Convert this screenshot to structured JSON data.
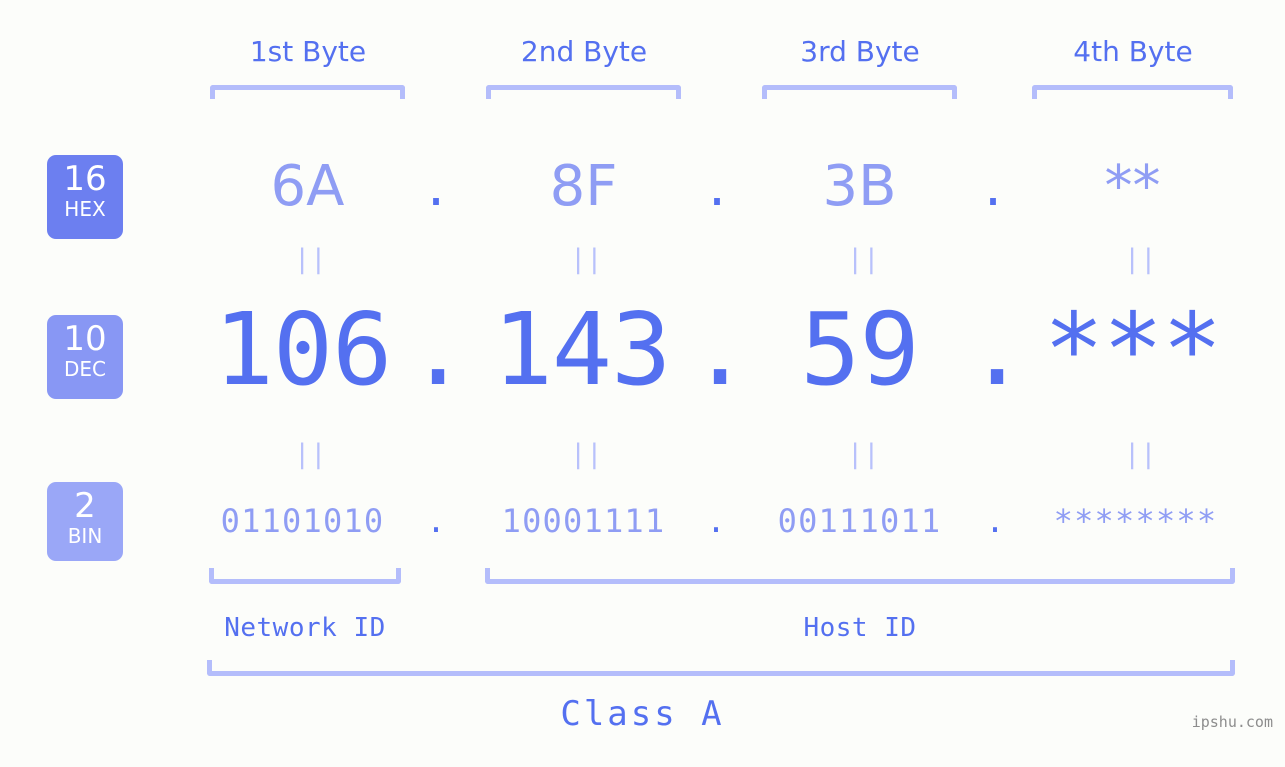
{
  "background_color": "#fcfdfa",
  "accent_color": "#5470f0",
  "accent_light_color": "#8f9df4",
  "bracket_color": "#b4bdfb",
  "byte_headers": [
    {
      "label": "1st Byte"
    },
    {
      "label": "2nd Byte"
    },
    {
      "label": "3rd Byte"
    },
    {
      "label": "4th Byte"
    }
  ],
  "bases": [
    {
      "num": "16",
      "sub": "HEX",
      "color": "#6c7ff0"
    },
    {
      "num": "10",
      "sub": "DEC",
      "color": "#8897f4"
    },
    {
      "num": "2",
      "sub": "BIN",
      "color": "#9aa7f7"
    }
  ],
  "rows": {
    "hex": {
      "values": [
        "6A",
        "8F",
        "3B",
        "**"
      ],
      "separator": "."
    },
    "dec": {
      "values": [
        "106",
        "143",
        "59",
        "***"
      ],
      "separator": "."
    },
    "bin": {
      "values": [
        "01101010",
        "10001111",
        "00111011",
        "********"
      ],
      "separator": "."
    }
  },
  "equal_mark": "||",
  "segments": {
    "network_id": "Network ID",
    "host_id": "Host ID"
  },
  "class_label": "Class A",
  "watermark": "ipshu.com"
}
